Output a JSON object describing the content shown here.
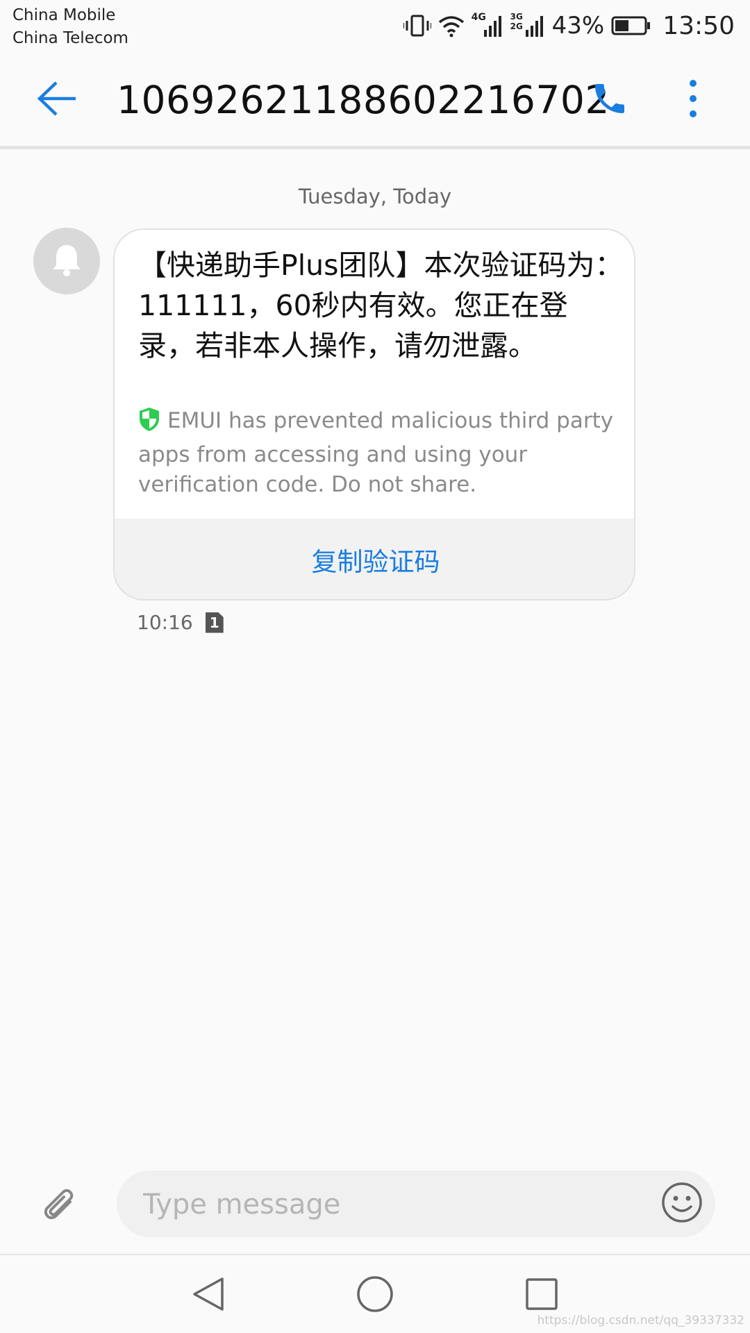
{
  "status_bar": {
    "carrier_1": "China Mobile",
    "carrier_2": "China Telecom",
    "battery_percent": "43%",
    "time": "13:50",
    "network_1": "4G",
    "network_2": "3G 2G"
  },
  "toolbar": {
    "title": "10692621188602216702"
  },
  "conversation": {
    "date_separator": "Tuesday, Today",
    "message": {
      "body": "【快递助手Plus团队】本次验证码为：111111，60秒内有效。您正在登录，若非本人操作，请勿泄露。",
      "security_note": "EMUI has prevented malicious third party apps from accessing and using your verification code. Do not share.",
      "copy_action_label": "复制验证码",
      "time": "10:16",
      "sim_slot": "1"
    }
  },
  "composer": {
    "placeholder": "Type message",
    "value": ""
  },
  "watermark": "https://blog.csdn.net/qq_39337332",
  "colors": {
    "accent": "#1a7de0",
    "shield": "#2ecc52",
    "background": "#fafafa"
  },
  "icons": [
    "back-arrow-icon",
    "phone-icon",
    "more-vertical-icon",
    "bell-icon",
    "shield-icon",
    "sim-icon",
    "paperclip-icon",
    "emoji-icon",
    "nav-back-icon",
    "nav-home-icon",
    "nav-recents-icon"
  ]
}
